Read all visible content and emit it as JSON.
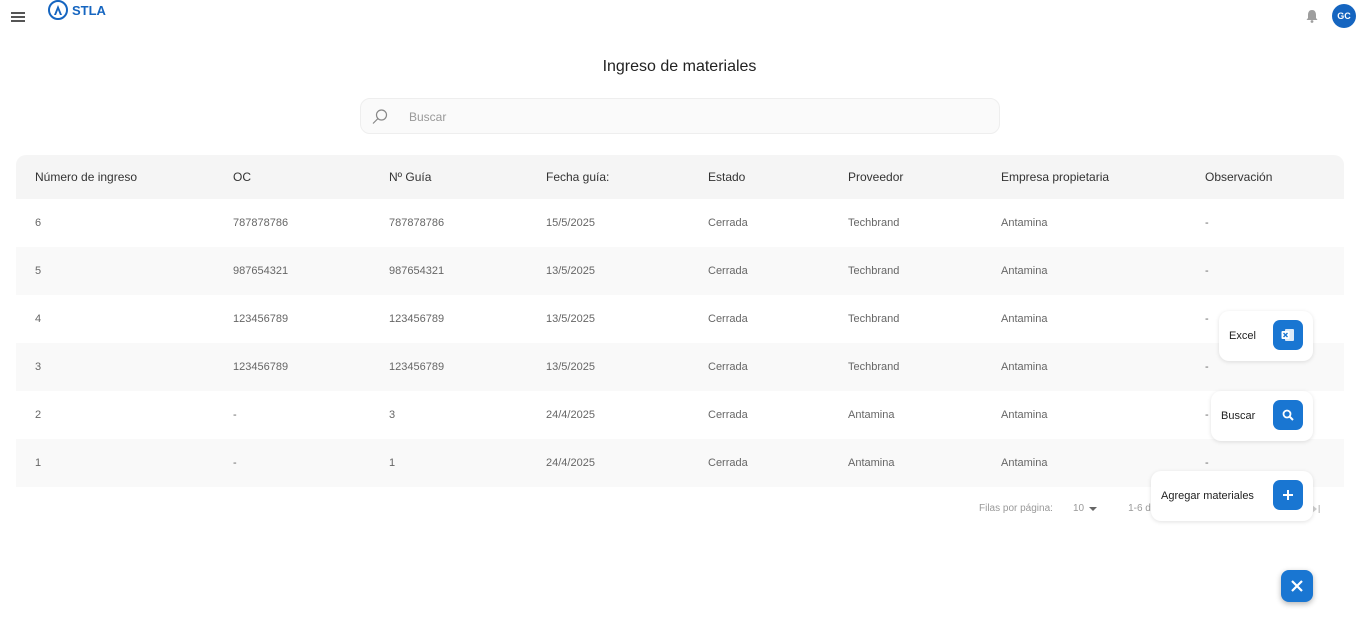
{
  "app": {
    "logo_text": "STLA",
    "avatar_initials": "GC"
  },
  "icons": {
    "menu": "hamburger-icon",
    "bell": "bell-icon",
    "search": "search-icon",
    "excel": "excel-icon",
    "fab_search": "search-icon",
    "add": "plus-icon",
    "close": "close-icon"
  },
  "colors": {
    "accent": "#1976d2",
    "brand": "#1565c0"
  },
  "page": {
    "title": "Ingreso de materiales"
  },
  "search": {
    "placeholder": "Buscar"
  },
  "table": {
    "headers": [
      "Número de ingreso",
      "OC",
      "Nº Guía",
      "Fecha guía:",
      "Estado",
      "Proveedor",
      "Empresa propietaria",
      "Observación"
    ],
    "rows": [
      [
        "6",
        "787878786",
        "787878786",
        "15/5/2025",
        "Cerrada",
        "Techbrand",
        "Antamina",
        "-"
      ],
      [
        "5",
        "987654321",
        "987654321",
        "13/5/2025",
        "Cerrada",
        "Techbrand",
        "Antamina",
        "-"
      ],
      [
        "4",
        "123456789",
        "123456789",
        "13/5/2025",
        "Cerrada",
        "Techbrand",
        "Antamina",
        "-"
      ],
      [
        "3",
        "123456789",
        "123456789",
        "13/5/2025",
        "Cerrada",
        "Techbrand",
        "Antamina",
        "-"
      ],
      [
        "2",
        "-",
        "3",
        "24/4/2025",
        "Cerrada",
        "Antamina",
        "Antamina",
        "-"
      ],
      [
        "1",
        "-",
        "1",
        "24/4/2025",
        "Cerrada",
        "Antamina",
        "Antamina",
        "-"
      ]
    ]
  },
  "pagination": {
    "rows_label": "Filas por página:",
    "rows_value": "10",
    "range_text": "1-6 de",
    "last_icon": "last-page-icon"
  },
  "fab_menu": {
    "excel_label": "Excel",
    "search_label": "Buscar",
    "add_label": "Agregar materiales"
  }
}
